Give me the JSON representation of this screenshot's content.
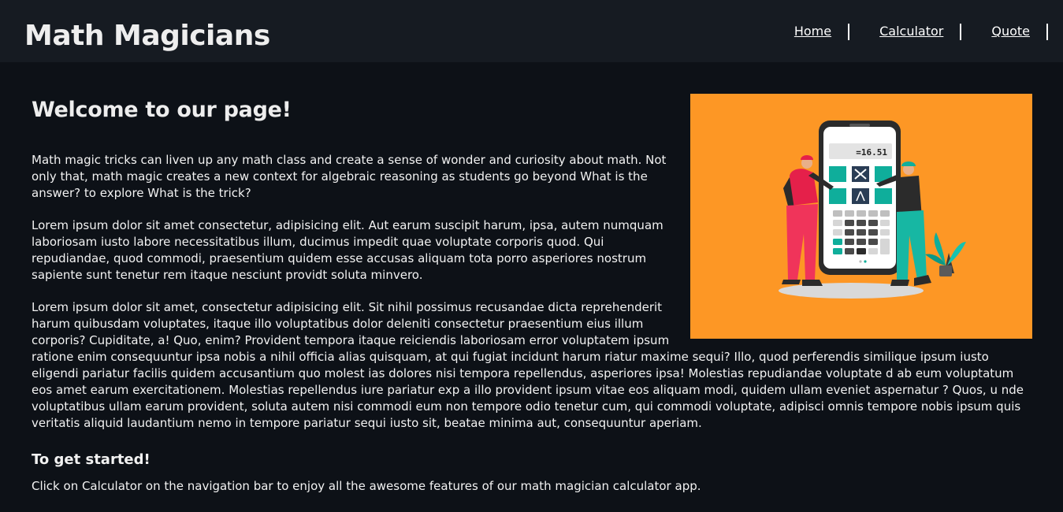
{
  "header": {
    "brand": "Math Magicians",
    "nav": [
      {
        "label": "Home"
      },
      {
        "label": "Calculator"
      },
      {
        "label": "Quote"
      }
    ]
  },
  "main": {
    "title": "Welcome to our page!",
    "paragraphs": [
      "Math magic tricks can liven up any math class and create a sense of wonder and curiosity about math. Not only that, math magic creates a new context for algebraic reasoning as students go beyond What is the answer? to explore What is the trick?",
      "Lorem ipsum dolor sit amet consectetur, adipisicing elit. Aut earum suscipit harum, ipsa, autem numquam laboriosam iusto labore necessitatibus illum, ducimus impedit quae voluptate corporis quod. Qui repudiandae, quod commodi, praesentium quidem esse accusas aliquam tota porro asperiores nostrum sapiente sunt tenetur rem itaque nesciunt providt soluta minvero.",
      "Lorem ipsum dolor sit amet, consectetur adipisicing elit. Sit nihil possimus recusandae dicta reprehenderit harum quibusdam voluptates, itaque illo voluptatibus dolor deleniti consectetur praesentium eius illum corporis? Cupiditate, a! Quo, enim? Provident tempora itaque reiciendis laboriosam error voluptatem ipsum ratione enim consequuntur ipsa nobis a nihil officia alias quisquam, at qui fugiat incidunt harum riatur maxime sequi? Illo, quod perferendis similique ipsum iusto eligendi pariatur facilis quidem accusantium quo molest ias dolores nisi tempora repellendus, asperiores ipsa! Molestias repudiandae voluptate d ab eum voluptatum eos amet earum exercitationem. Molestias repellendus iure pariatur exp a illo provident ipsum vitae eos aliquam modi, quidem ullam eveniet aspernatur ? Quos, u nde voluptatibus ullam earum provident, soluta autem nisi commodi eum non tempore odio tenetur cum, qui commodi voluptate, adipisci omnis tempore nobis ipsum quis veritatis aliquid laudantium nemo in tempore pariatur sequi iusto sit, beatae minima aut, consequuntur aperiam."
    ],
    "subheading": "To get started!",
    "instructions": "Click on Calculator on the navigation bar to enjoy all the awesome features of our math magician calculator app.",
    "illustration": {
      "display_value": "=16.51",
      "background_color": "#fd9725"
    }
  },
  "colors": {
    "page_background": "#0d1117",
    "header_background": "#161b22",
    "text": "#f2f2f2"
  }
}
